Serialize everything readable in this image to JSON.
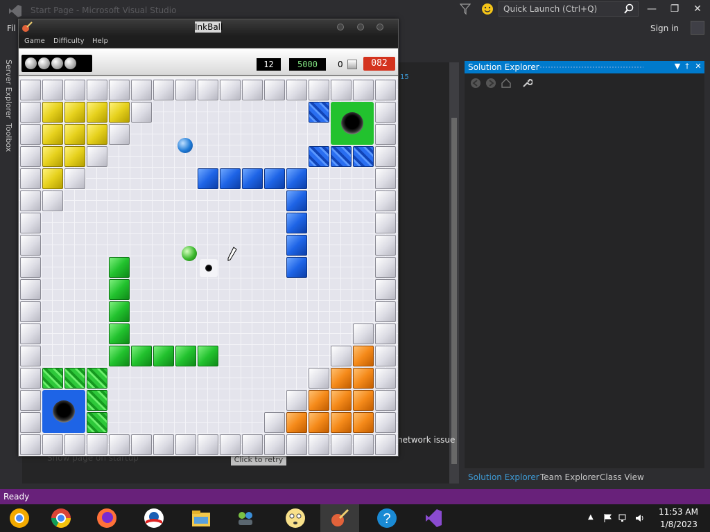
{
  "vs": {
    "title": "Start Page - Microsoft Visual Studio",
    "quick_launch": "Quick Launch (Ctrl+Q)",
    "menu_partial": "Fil",
    "sign_in": "Sign in",
    "left_tabs": [
      "Server Explorer",
      "Toolbox"
    ],
    "start_page": {
      "link_fragment": "15",
      "network_text": "network issue",
      "checkbox_label": "Show page on startup",
      "retry_label": "Click to retry"
    },
    "solution_explorer": {
      "title": "Solution Explorer",
      "bottom_tabs": [
        "Solution Explorer",
        "Team Explorer",
        "Class View"
      ]
    },
    "status": "Ready",
    "accent": "#68217a",
    "solution_header_color": "#007acc"
  },
  "inkball": {
    "title": "InkBall",
    "menu": [
      "Game",
      "Difficulty",
      "Help"
    ],
    "hud": {
      "queued_balls": 4,
      "level": "12",
      "score": "5000",
      "balls_count": "0",
      "timer": "082"
    },
    "colors": {
      "yellow": "#e6d11d",
      "blue": "#1e64e6",
      "green": "#22c22e",
      "orange": "#f58a1a",
      "gray": "#dcdce4"
    }
  },
  "taskbar": {
    "apps": [
      "chrome-canary",
      "chrome",
      "firefox",
      "obama-logo",
      "file-explorer",
      "network-people",
      "smiley",
      "paint",
      "help",
      "visual-studio"
    ],
    "active": "paint",
    "time": "11:53 AM",
    "date": "1/8/2023"
  }
}
